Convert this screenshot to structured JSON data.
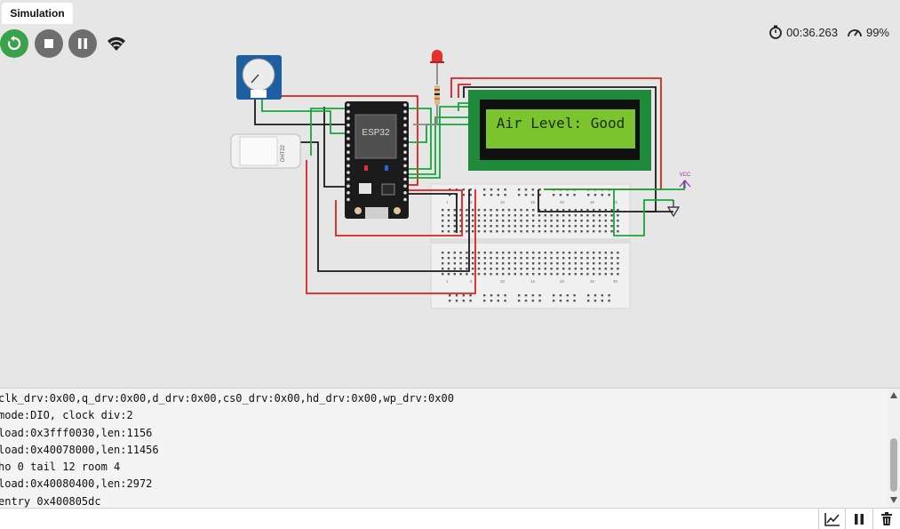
{
  "tab": {
    "label": "Simulation"
  },
  "status": {
    "timer": "00:36.263",
    "speed": "99%"
  },
  "circuit": {
    "lcd_text": "Air Level: Good",
    "esp_label": "ESP32",
    "dht_label": "DHT22",
    "vcc_label": "VCC",
    "breadboard_numbers": [
      "1",
      "5",
      "10",
      "15",
      "20",
      "25",
      "30"
    ]
  },
  "serial": {
    "lines": [
      "clk_drv:0x00,q_drv:0x00,d_drv:0x00,cs0_drv:0x00,hd_drv:0x00,wp_drv:0x00",
      "mode:DIO, clock div:2",
      "load:0x3fff0030,len:1156",
      "load:0x40078000,len:11456",
      "ho 0 tail 12 room 4",
      "load:0x40080400,len:2972",
      "entry 0x400805dc"
    ],
    "input_value": ""
  },
  "colors": {
    "accent_green": "#3aa24a",
    "lcd_green": "#7bc42d",
    "board_green": "#1f8a3c",
    "pot_blue": "#1d5fa0"
  }
}
